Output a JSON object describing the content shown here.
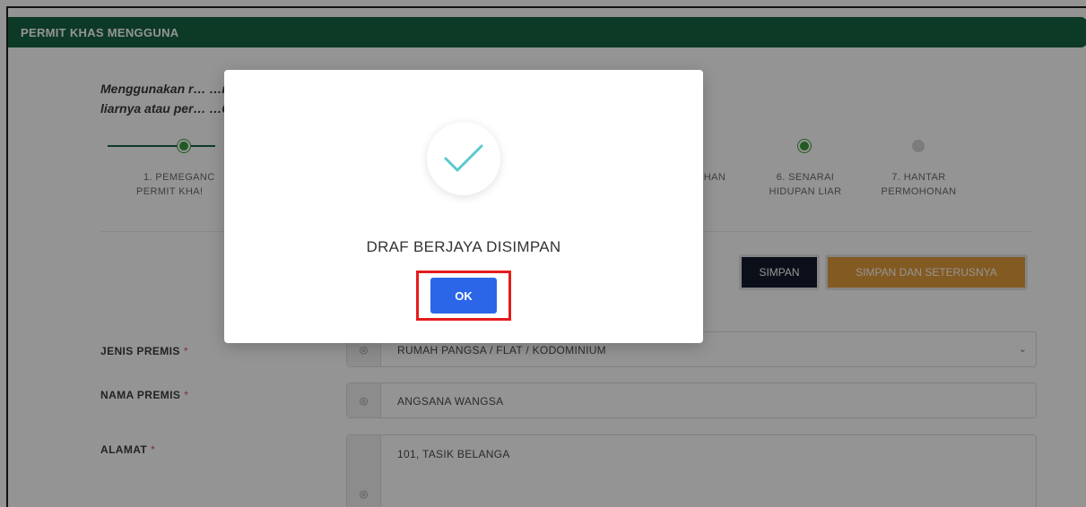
{
  "header": {
    "title": "PERMIT KHAS MENGGUNA"
  },
  "intro": {
    "line1": "Menggunakan r… …ndalian zoo, sarkas atau pameran hidupan",
    "line2": "liarnya atau per… …6)."
  },
  "stepper": {
    "steps": [
      {
        "label_line1": "1. PEMEGANC",
        "label_line2": "PERMIT KHA!",
        "status": "done"
      },
      {
        "label_line1": "EHAN",
        "label_line2": "",
        "status": "hidden"
      },
      {
        "label_line1": "6. SENARAI",
        "label_line2": "HIDUPAN LIAR",
        "status": "done"
      },
      {
        "label_line1": "7. HANTAR",
        "label_line2": "PERMOHONAN",
        "status": "pending"
      }
    ],
    "colors": {
      "done": "#3c9a3c",
      "pending": "#d6d6d6",
      "line": "#166543"
    }
  },
  "actions": {
    "save_label": "SIMPAN",
    "save_next_label": "SIMPAN DAN SETERUSNYA"
  },
  "form": {
    "jenis_premis": {
      "label": "JENIS PREMIS",
      "required_mark": "*",
      "value": "RUMAH PANGSA / FLAT / KODOMINIUM"
    },
    "nama_premis": {
      "label": "NAMA PREMIS",
      "required_mark": "*",
      "value": "ANGSANA WANGSA"
    },
    "alamat": {
      "label": "ALAMAT",
      "required_mark": "*",
      "value": "101, TASIK BELANGA"
    }
  },
  "modal": {
    "message": "DRAF BERJAYA DISIMPAN",
    "ok_label": "OK",
    "icon": "check-icon",
    "colors": {
      "check": "#5bc8cf",
      "ok_button": "#2b66e8",
      "highlight": "#e51c1c"
    }
  }
}
